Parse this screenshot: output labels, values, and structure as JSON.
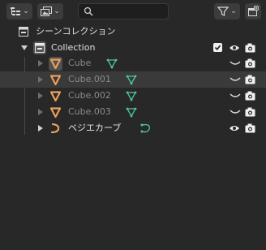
{
  "header": {
    "search": {
      "value": "",
      "placeholder": ""
    }
  },
  "tree": {
    "scene_collection": "シーンコレクション",
    "collection": "Collection",
    "objects": [
      {
        "name": "Cube"
      },
      {
        "name": "Cube.001"
      },
      {
        "name": "Cube.002"
      },
      {
        "name": "Cube.003"
      },
      {
        "name": "ベジエカーブ"
      }
    ]
  },
  "colors": {
    "background": "#282828",
    "selected_row": "#3a3a3a",
    "mesh_orange": "#e6a15a",
    "data_green": "#4fc4a4"
  },
  "icons": {
    "display_mode": "outliner-display-mode-icon",
    "filter_type": "image-filter-icon",
    "search": "search-icon",
    "filter": "filter-funnel-icon",
    "new_collection": "new-collection-icon",
    "scene_collection": "scene-collection-icon",
    "collection": "collection-icon",
    "mesh_object": "mesh-object-icon",
    "mesh_data": "mesh-data-icon",
    "curve_object": "curve-object-icon",
    "curve_data": "curve-data-icon",
    "visible": "eye-icon",
    "hidden": "eye-closed-icon",
    "render": "camera-icon",
    "checkbox": "checkbox-icon"
  }
}
